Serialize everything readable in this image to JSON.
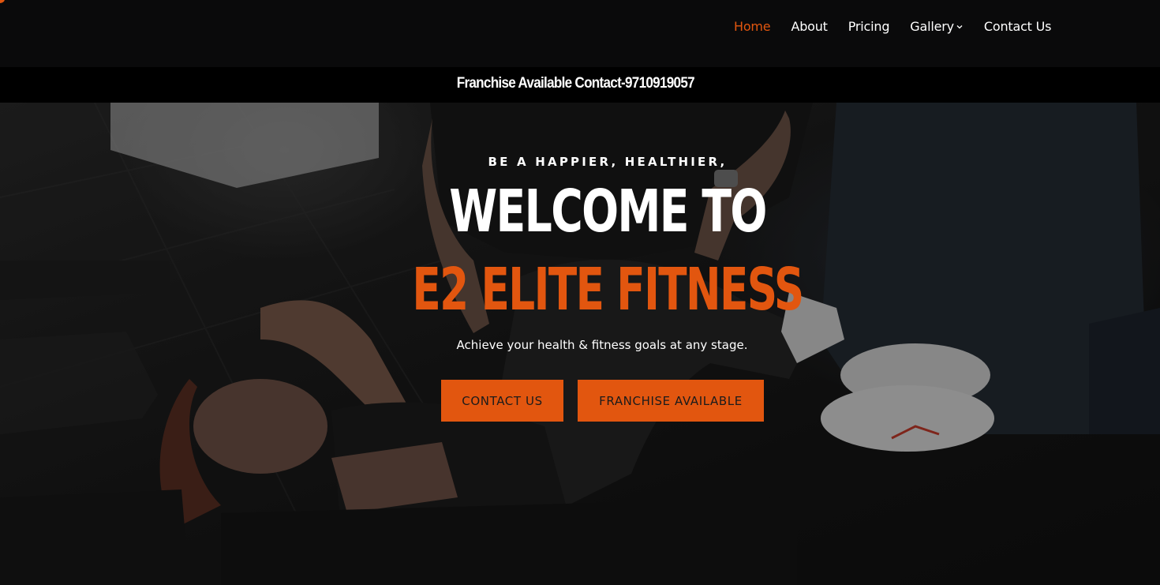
{
  "nav": {
    "items": [
      {
        "label": "Home",
        "active": true
      },
      {
        "label": "About",
        "active": false
      },
      {
        "label": "Pricing",
        "active": false
      },
      {
        "label": "Gallery",
        "active": false,
        "has_dropdown": true
      },
      {
        "label": "Contact Us",
        "active": false
      }
    ],
    "dropdown_icon": "chevron-down-icon"
  },
  "franchise_bar": {
    "text": "Franchise Available Contact-9710919057"
  },
  "hero": {
    "tagline": "BE A HAPPIER, HEALTHIER,",
    "headline_line1": "WELCOME TO",
    "headline_line2": "E2 ELITE FITNESS",
    "subline": "Achieve your health & fitness goals at any stage.",
    "buttons": {
      "contact": "CONTACT US",
      "franchise": "FRANCHISE AVAILABLE"
    }
  },
  "colors": {
    "accent": "#e2560f",
    "nav_bg": "#0a0a0b",
    "bar_bg": "#000000",
    "text": "#ffffff"
  }
}
